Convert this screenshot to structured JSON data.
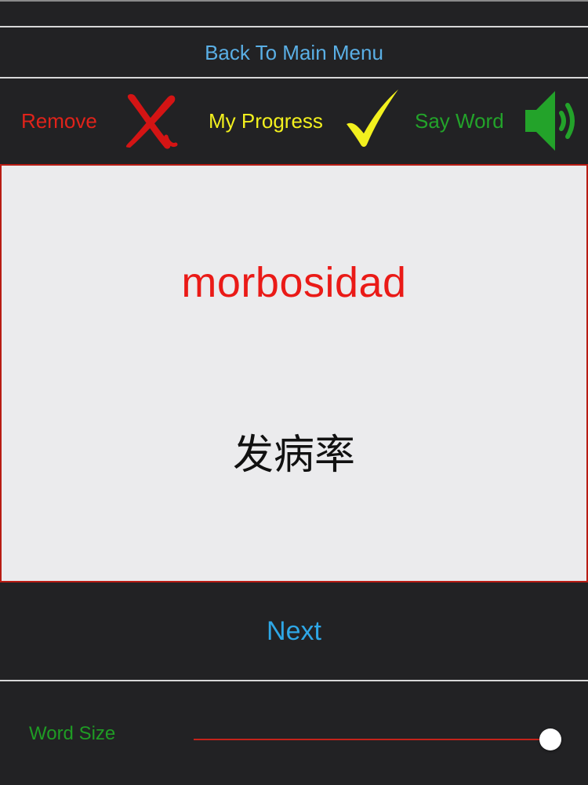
{
  "header": {
    "back_label": "Back To Main Menu"
  },
  "toolbar": {
    "remove_label": "Remove",
    "progress_label": "My Progress",
    "say_word_label": "Say Word",
    "remove_icon": "red-x-icon",
    "progress_icon": "yellow-checkmark-icon",
    "say_word_icon": "speaker-icon"
  },
  "card": {
    "word": "morbosidad",
    "translation": "发病率"
  },
  "next_label": "Next",
  "footer": {
    "word_size_label": "Word Size",
    "word_size_value": 1.0
  },
  "colors": {
    "background": "#222224",
    "link_blue": "#5aafe5",
    "next_blue": "#2ea7e6",
    "remove_red": "#e0231a",
    "progress_yellow": "#f2f01e",
    "say_green": "#23a32a",
    "card_bg": "#ebebed",
    "card_border": "#b81c14",
    "word_red": "#ea1a17",
    "word_size_green": "#1f9c24",
    "slider_track": "#c4231a"
  }
}
